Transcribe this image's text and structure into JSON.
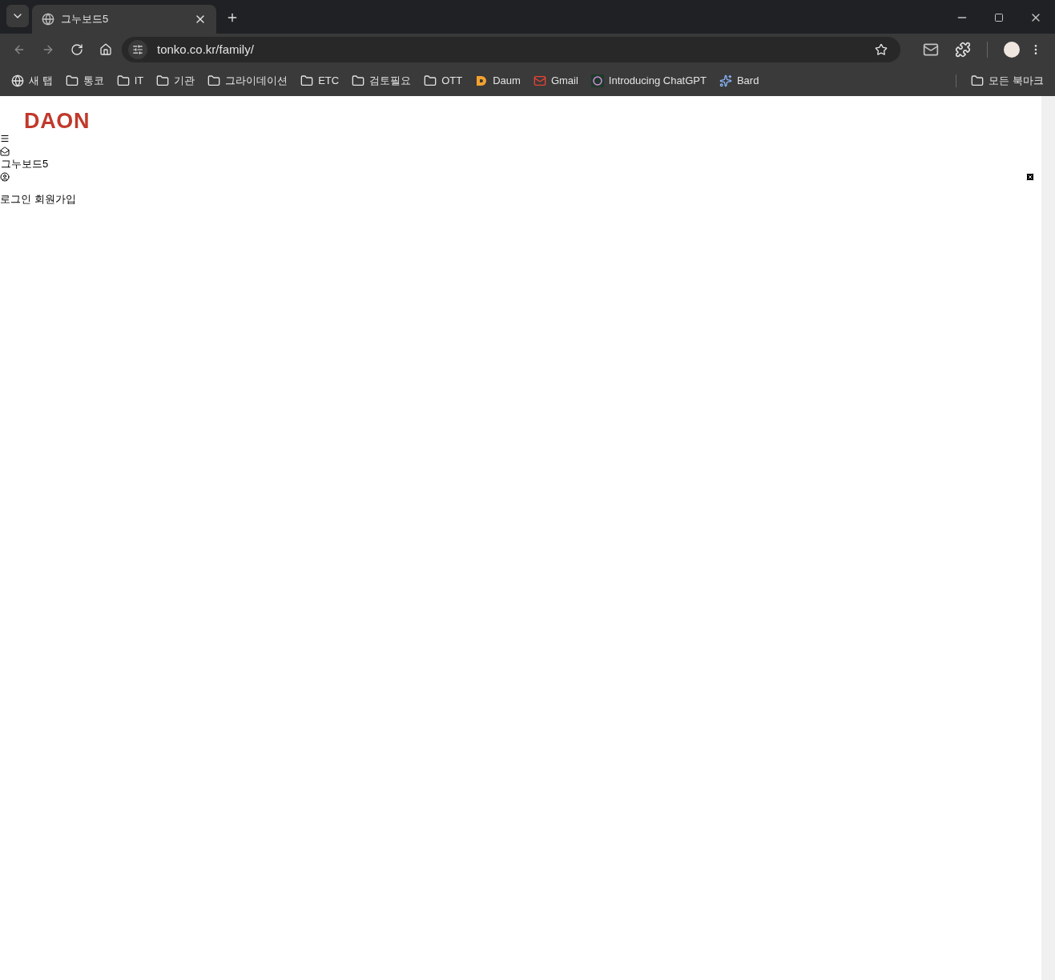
{
  "browser": {
    "tab": {
      "title": "그누보드5",
      "selected": true
    },
    "url": "tonko.co.kr/family/",
    "bookmarks": [
      {
        "kind": "web",
        "label": "새 탭"
      },
      {
        "kind": "folder",
        "label": "통코"
      },
      {
        "kind": "folder",
        "label": "IT"
      },
      {
        "kind": "folder",
        "label": "기관"
      },
      {
        "kind": "folder",
        "label": "그라이데이션"
      },
      {
        "kind": "folder",
        "label": "ETC"
      },
      {
        "kind": "folder",
        "label": "검토필요"
      },
      {
        "kind": "folder",
        "label": "OTT"
      },
      {
        "kind": "daum",
        "label": "Daum"
      },
      {
        "kind": "gmail",
        "label": "Gmail"
      },
      {
        "kind": "chatgpt",
        "label": "Introducing ChatGPT"
      },
      {
        "kind": "bard",
        "label": "Bard"
      }
    ],
    "all_bookmarks": {
      "kind": "folder",
      "label": "모든 북마크"
    }
  },
  "page": {
    "logo": "DAON",
    "site_title": "그누보드5",
    "links": [
      "로그인",
      "회원가입"
    ]
  }
}
